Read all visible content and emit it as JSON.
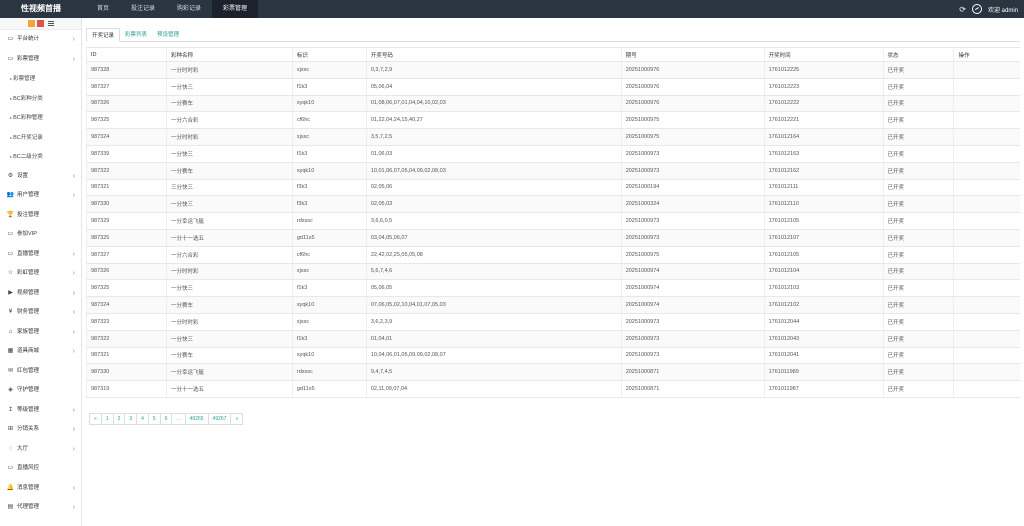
{
  "header": {
    "brand": "性视频首播",
    "nav": [
      "首页",
      "投注记录",
      "购彩记录",
      "彩票管理"
    ],
    "active_nav": 3,
    "user": "欢迎 admin",
    "refresh_icon": "refresh-icon",
    "avatar_icon": "avatar-icon"
  },
  "sidebar": {
    "items": [
      {
        "icon": "monitor-icon",
        "glyph": "▭",
        "label": "平台统计",
        "chev": true
      },
      {
        "icon": "monitor-icon",
        "glyph": "▭",
        "label": "彩票管理",
        "chev": true,
        "open": true
      },
      {
        "sub": true,
        "label": "彩票管理"
      },
      {
        "sub": true,
        "label": "BC彩种分类"
      },
      {
        "sub": true,
        "label": "BC彩种管理"
      },
      {
        "sub": true,
        "label": "BC开奖记录"
      },
      {
        "sub": true,
        "label": "BC二级分类"
      },
      {
        "icon": "gears-icon",
        "glyph": "⚙",
        "label": "设置",
        "chev": true
      },
      {
        "icon": "users-icon",
        "glyph": "👥",
        "label": "用户管理",
        "chev": true
      },
      {
        "icon": "trophy-icon",
        "glyph": "🏆",
        "label": "投注管理",
        "chev": false
      },
      {
        "icon": "monitor-icon",
        "glyph": "▭",
        "label": "参加VIP",
        "chev": false
      },
      {
        "icon": "monitor-icon",
        "glyph": "▭",
        "label": "直播管理",
        "chev": true
      },
      {
        "icon": "star-icon",
        "glyph": "☆",
        "label": "彩虹管理",
        "chev": true
      },
      {
        "icon": "video-icon",
        "glyph": "▶",
        "label": "视频管理",
        "chev": true
      },
      {
        "icon": "yen-icon",
        "glyph": "¥",
        "label": "财务管理",
        "chev": true
      },
      {
        "icon": "bank-icon",
        "glyph": "⌂",
        "label": "家族管理",
        "chev": true
      },
      {
        "icon": "shop-icon",
        "glyph": "▦",
        "label": "道具商城",
        "chev": true
      },
      {
        "icon": "mail-icon",
        "glyph": "✉",
        "label": "红包管理",
        "chev": false
      },
      {
        "icon": "shield-icon",
        "glyph": "◈",
        "label": "守护管理",
        "chev": false
      },
      {
        "icon": "pin-icon",
        "glyph": "↥",
        "label": "等级管理",
        "chev": true
      },
      {
        "icon": "sitemap-icon",
        "glyph": "⊞",
        "label": "分销关系",
        "chev": true
      },
      {
        "icon": "chat-icon",
        "glyph": "◌",
        "label": "大厅",
        "chev": true
      },
      {
        "icon": "monitor-icon",
        "glyph": "▭",
        "label": "直播风控",
        "chev": false
      },
      {
        "icon": "bell-icon",
        "glyph": "🔔",
        "label": "消息管理",
        "chev": true
      },
      {
        "icon": "doc-icon",
        "glyph": "▤",
        "label": "代理管理",
        "chev": true
      }
    ]
  },
  "tabs": [
    "开奖记录",
    "彩票列表",
    "预设管理"
  ],
  "table": {
    "headers": [
      "ID",
      "彩种名称",
      "标识",
      "开奖号码",
      "期号",
      "开奖时间",
      "状态",
      "操作"
    ],
    "rows": [
      [
        "987328",
        "一分时时彩",
        "xjssc",
        "0,3,7,2,9",
        "20251000976",
        "1761012225",
        "已开奖",
        ""
      ],
      [
        "987327",
        "一分快三",
        "f1k3",
        "05,06,04",
        "20251000976",
        "1761012223",
        "已开奖",
        ""
      ],
      [
        "987326",
        "一分赛车",
        "xyqk10",
        "01,08,06,07,01,04,04,10,02,03",
        "20251000976",
        "1761012222",
        "已开奖",
        ""
      ],
      [
        "987325",
        "一分六合彩",
        "cf6hc",
        "01,22,04,24,15,40,27",
        "20251000975",
        "1761012221",
        "已开奖",
        ""
      ],
      [
        "987324",
        "一分时时彩",
        "xjssc",
        "3,5,7,2,5",
        "20251000975",
        "1761012164",
        "已开奖",
        ""
      ],
      [
        "987339",
        "一分快三",
        "f1k3",
        "01,06,03",
        "20251000973",
        "1761012163",
        "已开奖",
        ""
      ],
      [
        "987322",
        "一分赛车",
        "xyqk10",
        "10,01,06,07,05,04,09,02,08,03",
        "20251000973",
        "1761012162",
        "已开奖",
        ""
      ],
      [
        "987321",
        "三分快三",
        "f3k3",
        "02,05,06",
        "20251000194",
        "1761012111",
        "已开奖",
        ""
      ],
      [
        "987330",
        "一分快三",
        "f3k3",
        "02,05,03",
        "20251000324",
        "1761012110",
        "已开奖",
        ""
      ],
      [
        "987329",
        "一分幸运飞艇",
        "rdxssc",
        "3,6,6,0,5",
        "20251000973",
        "1761012105",
        "已开奖",
        ""
      ],
      [
        "987325",
        "一分十一选五",
        "gd11x5",
        "03,04,05,06,07",
        "20251000973",
        "1761012107",
        "已开奖",
        ""
      ],
      [
        "987327",
        "一分六合彩",
        "cf6hc",
        "22,42,02,25,05,05,08",
        "20251000975",
        "1761012105",
        "已开奖",
        ""
      ],
      [
        "987326",
        "一分时时彩",
        "xjssc",
        "5,6,7,4,6",
        "20251000974",
        "1761012104",
        "已开奖",
        ""
      ],
      [
        "987325",
        "一分快三",
        "f1k3",
        "05,06,05",
        "20251000974",
        "1761012103",
        "已开奖",
        ""
      ],
      [
        "987324",
        "一分赛车",
        "xyqk10",
        "07,06,05,02,10,04,01,07,05,03",
        "20251000974",
        "1761012102",
        "已开奖",
        ""
      ],
      [
        "987323",
        "一分时时彩",
        "xjssc",
        "3,6,2,3,9",
        "20251000973",
        "1761012044",
        "已开奖",
        ""
      ],
      [
        "987322",
        "一分快三",
        "f1k3",
        "01,04,01",
        "20251000973",
        "1761012043",
        "已开奖",
        ""
      ],
      [
        "987321",
        "一分赛车",
        "xyqk10",
        "10,04,06,01,05,09,09,02,08,07",
        "20251000973",
        "1761012041",
        "已开奖",
        ""
      ],
      [
        "987330",
        "一分幸运飞艇",
        "rdxssc",
        "9,4,7,4,5",
        "20251000871",
        "1761011989",
        "已开奖",
        ""
      ],
      [
        "987319",
        "一分十一选五",
        "gd11x5",
        "02,11,09,07,04",
        "20251000871",
        "1761011987",
        "已开奖",
        ""
      ]
    ]
  },
  "pagination": [
    "«",
    "1",
    "2",
    "3",
    "4",
    "5",
    "6",
    "...",
    "49265",
    "49267",
    "»"
  ]
}
